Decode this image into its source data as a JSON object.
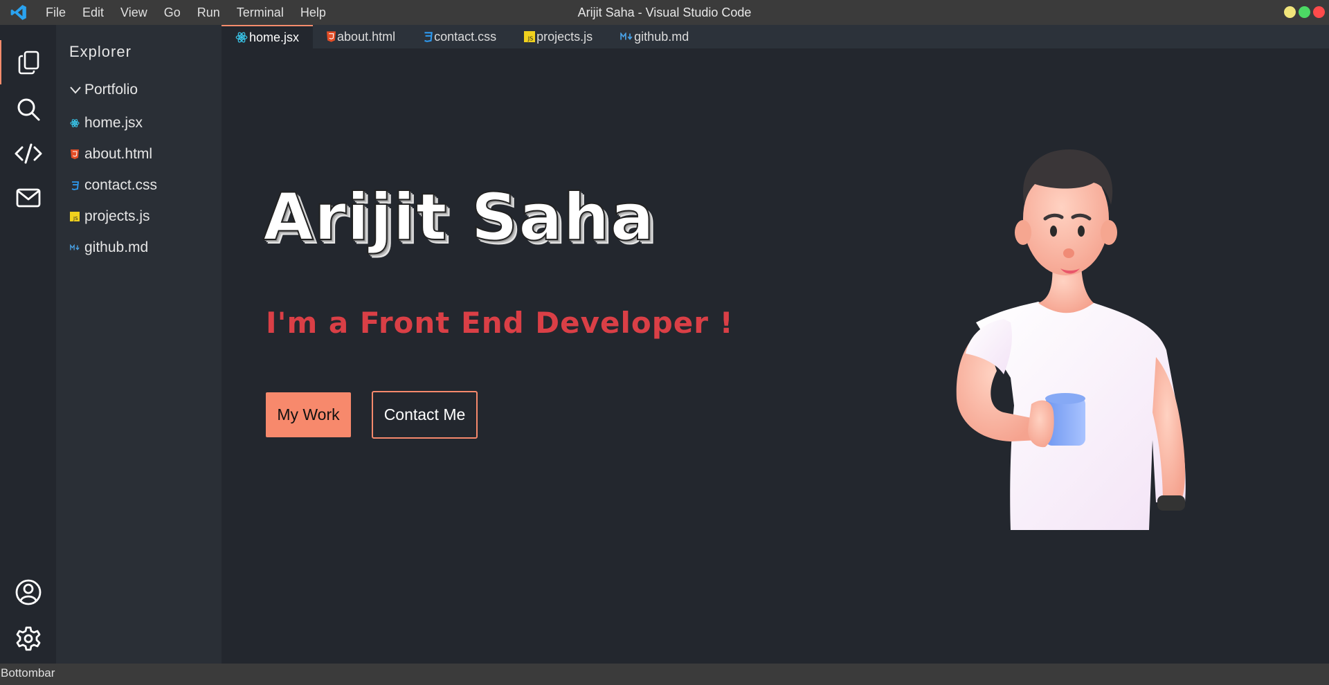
{
  "titlebar": {
    "title": "Arijit Saha - Visual Studio Code",
    "menu": [
      "File",
      "Edit",
      "View",
      "Go",
      "Run",
      "Terminal",
      "Help"
    ],
    "window_controls": [
      "#f1e57b",
      "#4cd964",
      "#ff4b4b"
    ]
  },
  "activitybar": {
    "items": [
      "files-icon",
      "search-icon",
      "code-icon",
      "mail-icon"
    ],
    "bottom": [
      "account-icon",
      "gear-icon"
    ],
    "accent": "#f78c6c"
  },
  "sidebar": {
    "title": "Explorer",
    "folder": "Portfolio",
    "files": [
      {
        "name": "home.jsx",
        "icon": "react-icon"
      },
      {
        "name": "about.html",
        "icon": "html-icon"
      },
      {
        "name": "contact.css",
        "icon": "css-icon"
      },
      {
        "name": "projects.js",
        "icon": "js-icon"
      },
      {
        "name": "github.md",
        "icon": "markdown-icon"
      }
    ]
  },
  "tabs": [
    {
      "label": "home.jsx",
      "active": true
    },
    {
      "label": "about.html"
    },
    {
      "label": "contact.css"
    },
    {
      "label": "projects.js"
    },
    {
      "label": "github.md"
    }
  ],
  "hero": {
    "name": "Arijit Saha",
    "subtitle": "I'm a Front End Developer !",
    "primary_button": "My Work",
    "secondary_button": "Contact Me",
    "accent": "#f7896c",
    "subtitle_color": "#da3f46"
  },
  "bottombar": {
    "label": "Bottombar"
  }
}
